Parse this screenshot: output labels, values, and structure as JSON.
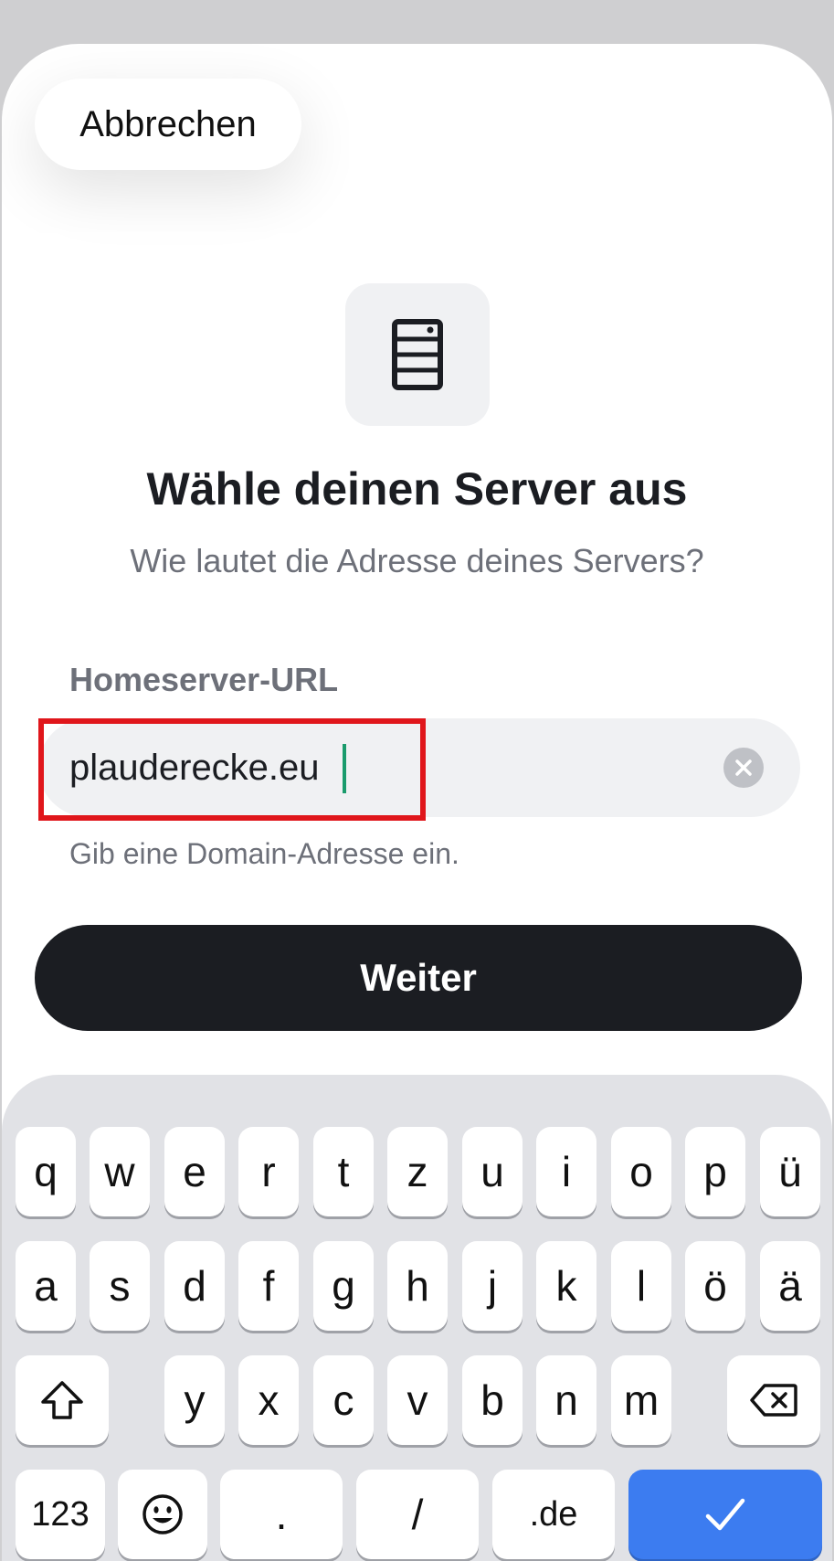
{
  "header": {
    "cancel_label": "Abbrechen"
  },
  "main": {
    "title": "Wähle deinen Server aus",
    "subtitle": "Wie lautet die Adresse deines Servers?",
    "field_label": "Homeserver-URL",
    "url_value": "plauderecke.eu",
    "hint": "Gib eine Domain-Adresse ein.",
    "continue_label": "Weiter"
  },
  "keyboard": {
    "row1": [
      "q",
      "w",
      "e",
      "r",
      "t",
      "z",
      "u",
      "i",
      "o",
      "p",
      "ü"
    ],
    "row2": [
      "a",
      "s",
      "d",
      "f",
      "g",
      "h",
      "j",
      "k",
      "l",
      "ö",
      "ä"
    ],
    "row3": [
      "y",
      "x",
      "c",
      "v",
      "b",
      "n",
      "m"
    ],
    "bottom": {
      "numbers": "123",
      "period": ".",
      "slash": "/",
      "domain": ".de"
    }
  },
  "colors": {
    "accent_cursor": "#1a9b6c",
    "primary_button": "#1b1d22",
    "keyboard_done": "#3c7cf0",
    "highlight": "#e0161b"
  },
  "icons": {
    "server": "server-icon",
    "clear": "clear-icon",
    "shift": "shift-icon",
    "backspace": "backspace-icon",
    "emoji": "emoji-icon",
    "done": "checkmark-icon"
  }
}
